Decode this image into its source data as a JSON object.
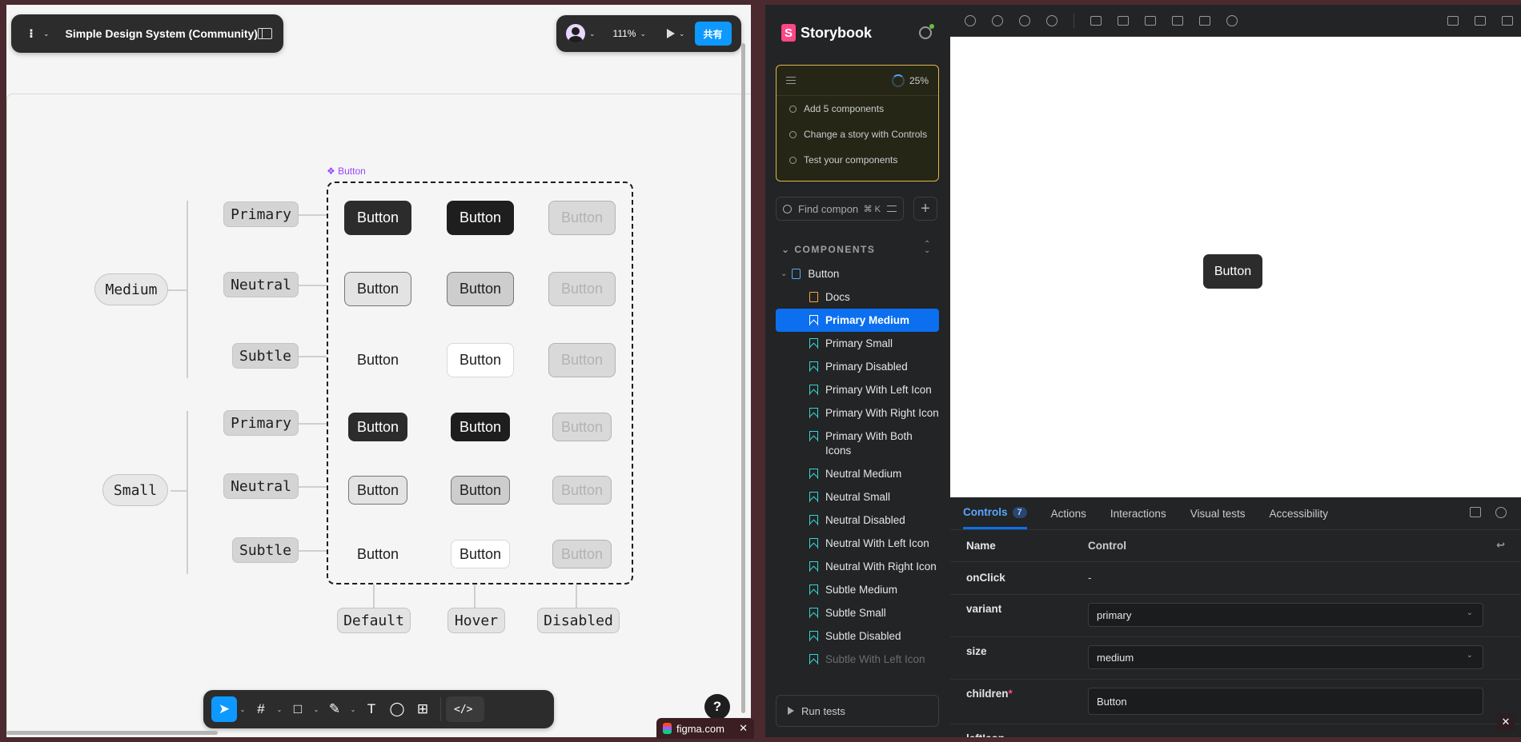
{
  "figma": {
    "file_name": "Simple Design System (Community)",
    "zoom": "111%",
    "share_label": "共有",
    "help_label": "?",
    "component_label": "❖ Button",
    "size_labels": [
      "Medium",
      "Small"
    ],
    "prop_labels": [
      "Primary",
      "Neutral",
      "Subtle",
      "Primary",
      "Neutral",
      "Subtle"
    ],
    "state_labels": [
      "Default",
      "Hover",
      "Disabled"
    ],
    "button_text": "Button",
    "tools": [
      "move-tool",
      "frame-tool",
      "shape-tool",
      "pen-tool",
      "text-tool",
      "comment-tool",
      "actions-tool",
      "dev-mode-tool"
    ]
  },
  "browser_tab": {
    "title": "figma.com",
    "close": "✕"
  },
  "storybook": {
    "brand": "Storybook",
    "checklist": {
      "progress": "25%",
      "items": [
        "Add 5 components",
        "Change a story with Controls",
        "Test your components"
      ]
    },
    "search": {
      "placeholder": "Find compon",
      "shortcut": "⌘ K"
    },
    "section_title": "COMPONENTS",
    "tree": {
      "component": "Button",
      "docs": "Docs",
      "stories": [
        "Primary Medium",
        "Primary Small",
        "Primary Disabled",
        "Primary With Left Icon",
        "Primary With Right Icon",
        "Primary With Both Icons",
        "Neutral Medium",
        "Neutral Small",
        "Neutral Disabled",
        "Neutral With Left Icon",
        "Neutral With Right Icon",
        "Subtle Medium",
        "Subtle Small",
        "Subtle Disabled",
        "Subtle With Left Icon"
      ],
      "selected": "Primary Medium"
    },
    "run_tests": "Run tests",
    "preview_button": "Button",
    "addon_tabs": {
      "controls": "Controls",
      "controls_count": "7",
      "actions": "Actions",
      "interactions": "Interactions",
      "visual_tests": "Visual tests",
      "accessibility": "Accessibility"
    },
    "controls": {
      "col_name": "Name",
      "col_control": "Control",
      "rows": {
        "onclick": {
          "name": "onClick",
          "value": "-"
        },
        "variant": {
          "name": "variant",
          "value": "primary"
        },
        "size": {
          "name": "size",
          "value": "medium"
        },
        "children": {
          "name": "children",
          "required": "*",
          "value": "Button"
        },
        "lefticon": {
          "name": "leftIcon"
        }
      }
    }
  },
  "colors": {
    "figma_blue": "#0d99ff",
    "storybook_pink": "#ff4785",
    "storybook_selected": "#0b6ff0",
    "checklist_border": "#e0b64a",
    "variant_purple": "#9747ff"
  }
}
